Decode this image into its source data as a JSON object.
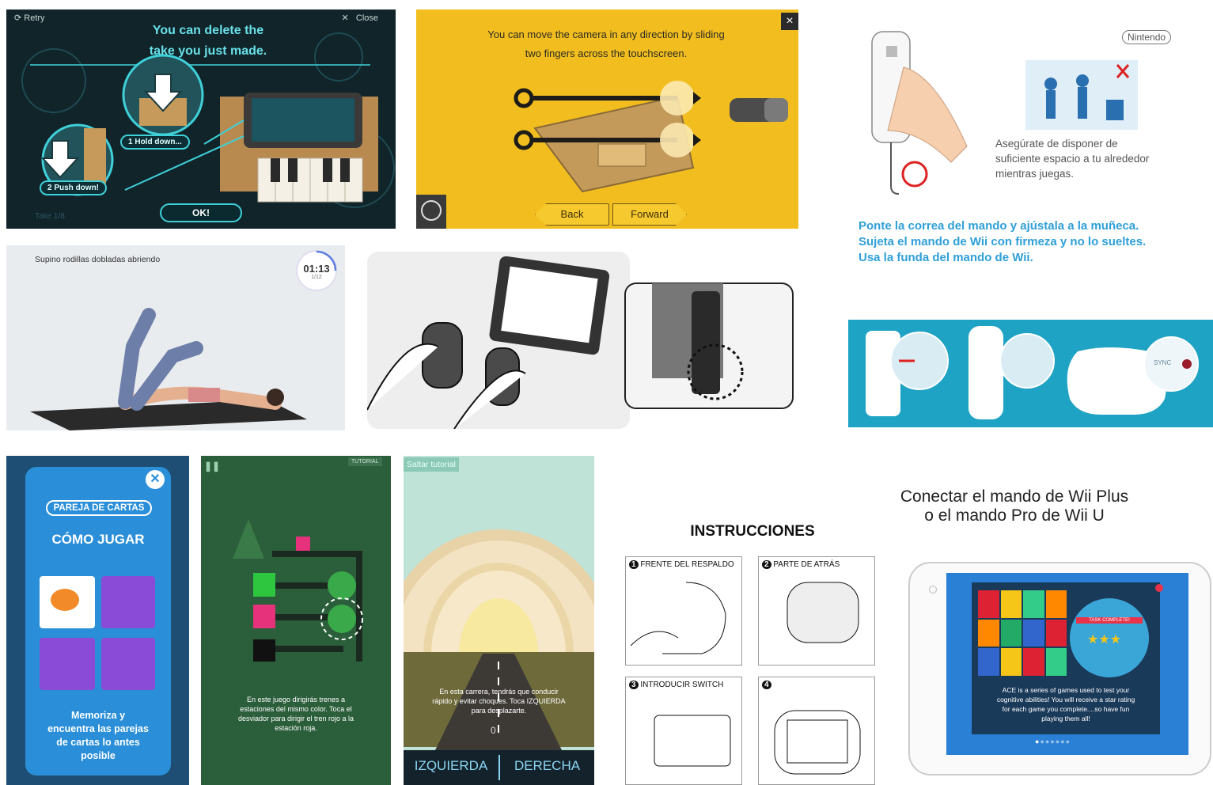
{
  "tile1": {
    "retry": "Retry",
    "close": "Close",
    "caption_line1": "You can delete the",
    "caption_line2": "take you just made.",
    "step1": "Hold down...",
    "step1_num": "1",
    "step2": "Push down!",
    "step2_num": "2",
    "ok": "OK!",
    "take": "Take 1/8"
  },
  "tile2": {
    "caption_line1": "You can move the camera in any direction by sliding",
    "caption_line2": "two fingers across the touchscreen.",
    "back": "Back",
    "forward": "Forward",
    "close": "×"
  },
  "tile3": {
    "brand": "Nintendo",
    "safety_text1": "Asegúrate de disponer de",
    "safety_text2": "suficiente espacio a tu alrededor",
    "safety_text3": "mientras juegas.",
    "blue_text1": "Ponte la correa del mando y ajústala a la muñeca.",
    "blue_text2": "Sujeta el mando de Wii con firmeza y no lo sueltes.",
    "blue_text3": "Usa la funda del mando de Wii."
  },
  "tile4": {
    "exercise": "Supino rodillas dobladas abriendo",
    "timer": "01:13",
    "progress": "1/12",
    "progress_fraction": 0.25
  },
  "tile6": {
    "sync": "SYNC"
  },
  "tile7": {
    "badge": "PAREJA DE CARTAS",
    "heading": "CÓMO JUGAR",
    "body1": "Memoriza y",
    "body2": "encuentra las parejas",
    "body3": "de cartas lo antes",
    "body4": "posible"
  },
  "tile8": {
    "tag": "TUTORIAL",
    "text1": "En este juego dirigirás trenes a",
    "text2": "estaciones del mismo color. Toca el",
    "text3": "desviador para dirigir el tren rojo a la",
    "text4": "estación roja."
  },
  "tile9": {
    "skip": "Saltar tutorial",
    "text1": "En esta carrera, tendrás que conducir",
    "text2": "rápido y evitar choques. Toca IZQUIERDA",
    "text3": "para desplazarte.",
    "counter": "0",
    "left": "IZQUIERDA",
    "right": "DERECHA"
  },
  "tile10": {
    "title": "INSTRUCCIONES",
    "step1": "FRENTE DEL RESPALDO",
    "step2": "PARTE DE ATRÁS",
    "step3": "INTRODUCIR SWITCH",
    "num1": "1",
    "num2": "2",
    "num3": "3",
    "num4": "4"
  },
  "tile11": {
    "title1": "Conectar el mando de Wii Plus",
    "title2": "o el mando Pro de Wii U",
    "ribbon": "TASK COMPLETE!",
    "desc1": "ACE is a series of games used to test your",
    "desc2": "cognitive abilities! You will receive a star rating",
    "desc3": "for each game you complete....so have fun",
    "desc4": "playing them all!"
  },
  "colors": {
    "labo_cyan": "#3fd0d8",
    "camera_yellow": "#f2be1f",
    "wii_blue": "#1fa3c4",
    "cards_blue": "#2a8fd8",
    "train_green": "#2b5e3a"
  }
}
